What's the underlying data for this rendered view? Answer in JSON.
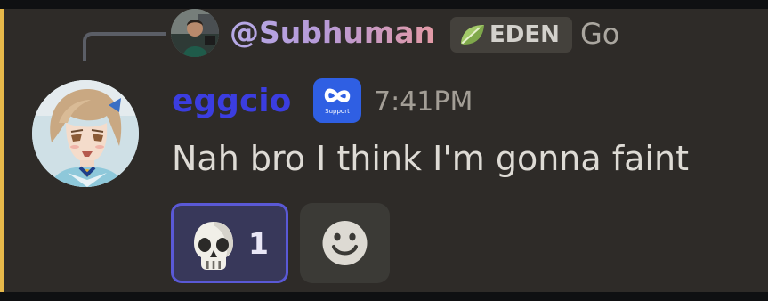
{
  "reply": {
    "username": "@Subhuman",
    "tag": "EDEN",
    "preview_text": "Go"
  },
  "message": {
    "username": "eggcio",
    "app_badge_label": "Support",
    "app_badge_icon": "infinity-icon",
    "timestamp": "7:41PM",
    "text": "Nah bro I think I'm gonna faint"
  },
  "reactions": [
    {
      "emoji": "skull",
      "count": "1",
      "selected": true
    }
  ],
  "add_reaction": {
    "icon": "smiley-icon"
  },
  "colors": {
    "accent_bar": "#e6b84a",
    "username": "#3b3de0",
    "reaction_border": "#5a59d6",
    "reply_name_gradient": [
      "#b5a9e6",
      "#e39aa5"
    ]
  }
}
